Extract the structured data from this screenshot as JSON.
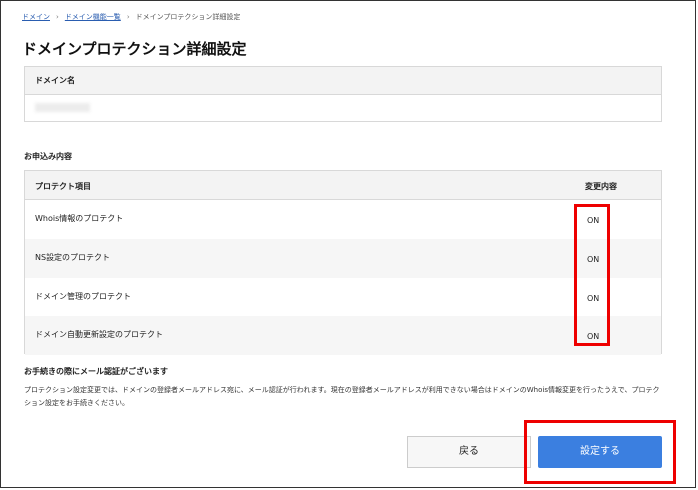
{
  "breadcrumb": {
    "item1": "ドメイン",
    "item2": "ドメイン機能一覧",
    "item3": "ドメインプロテクション詳細設定"
  },
  "page": {
    "title": "ドメインプロテクション詳細設定"
  },
  "domain_table": {
    "header": "ドメイン名"
  },
  "application": {
    "section_label": "お申込み内容",
    "col_item": "プロテクト項目",
    "col_change": "変更内容",
    "rows": [
      {
        "name": "Whois情報のプロテクト",
        "status": "ON"
      },
      {
        "name": "NS設定のプロテクト",
        "status": "ON"
      },
      {
        "name": "ドメイン管理のプロテクト",
        "status": "ON"
      },
      {
        "name": "ドメイン自動更新設定のプロテクト",
        "status": "ON"
      }
    ]
  },
  "notice": {
    "title": "お手続きの際にメール認証がございます",
    "body": "プロテクション設定変更では、ドメインの登録者メールアドレス宛に、メール認証が行われます。現在の登録者メールアドレスが利用できない場合はドメインのWhois情報変更を行ったうえで、プロテクション設定をお手続きください。"
  },
  "buttons": {
    "back": "戻る",
    "submit": "設定する"
  },
  "colors": {
    "accent_blue": "#3b7fe0",
    "highlight_red": "#ee0000"
  }
}
